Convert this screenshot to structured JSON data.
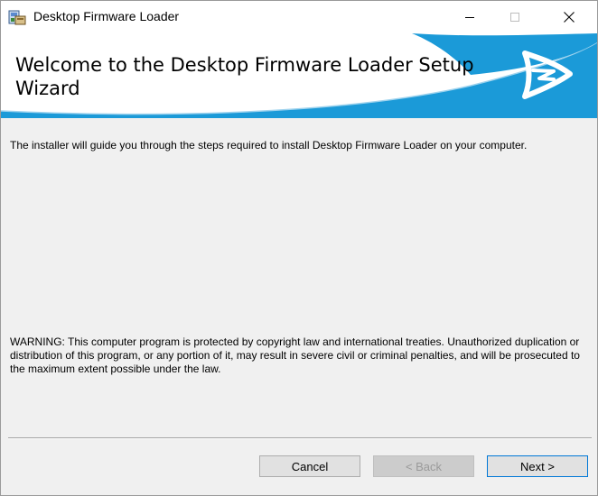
{
  "window": {
    "title": "Desktop Firmware Loader"
  },
  "banner": {
    "title": "Welcome to the Desktop Firmware Loader Setup Wizard"
  },
  "content": {
    "intro": "The installer will guide you through the steps required to install Desktop Firmware Loader on your computer.",
    "warning": "WARNING: This computer program is protected by copyright law and international treaties. Unauthorized duplication or distribution of this program, or any portion of it, may result in severe civil or criminal penalties, and will be prosecuted to the maximum extent possible under the law."
  },
  "buttons": {
    "cancel": "Cancel",
    "back": "< Back",
    "next": "Next >"
  },
  "colors": {
    "banner_blue": "#1b9ad8",
    "focus_blue": "#0078d7"
  },
  "icons": [
    "installer-app-icon",
    "minimize-icon",
    "maximize-icon",
    "close-icon",
    "brand-logo-icon"
  ]
}
